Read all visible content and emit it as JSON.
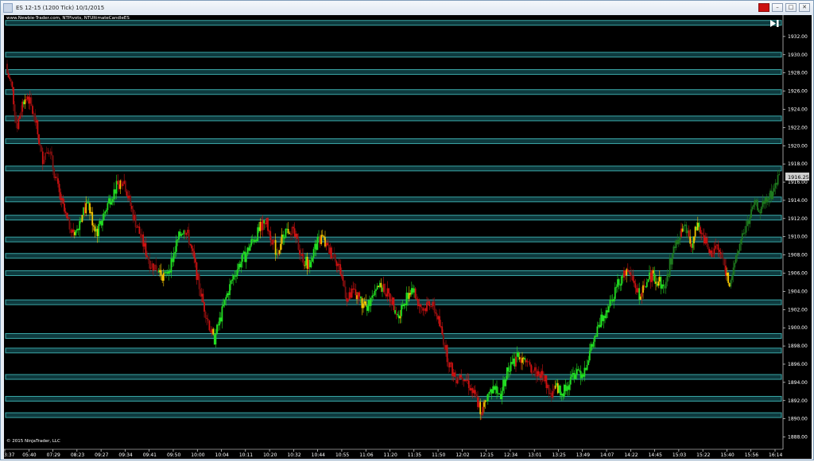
{
  "window": {
    "title": "ES 12-15 (1200 Tick)  10/1/2015",
    "buttons": {
      "close_color": "#cc1111"
    }
  },
  "chart": {
    "caption": "www.Newbie-Trader.com, NTPivots, NTUltimateCandleES",
    "copyright": "© 2015 NinjaTrader, LLC",
    "current_price": "1916.25"
  },
  "chart_data": {
    "type": "candlestick",
    "y_range": [
      1887,
      1934
    ],
    "y_ticks": [
      "1932.00",
      "1930.00",
      "1928.00",
      "1926.00",
      "1924.00",
      "1922.00",
      "1920.00",
      "1918.00",
      "1916.00",
      "1914.00",
      "1912.00",
      "1910.00",
      "1908.00",
      "1906.00",
      "1904.00",
      "1902.00",
      "1900.00",
      "1898.00",
      "1896.00",
      "1894.00",
      "1892.00",
      "1890.00",
      "1888.00"
    ],
    "x_ticks": [
      "3:37",
      "05:40",
      "07:29",
      "08:23",
      "09:27",
      "09:34",
      "09:41",
      "09:50",
      "10:00",
      "10:04",
      "10:11",
      "10:20",
      "10:32",
      "10:44",
      "10:55",
      "11:06",
      "11:20",
      "11:35",
      "11:50",
      "12:02",
      "12:15",
      "12:34",
      "13:01",
      "13:25",
      "13:49",
      "14:07",
      "14:22",
      "14:45",
      "15:03",
      "15:22",
      "15:40",
      "15:56",
      "16:14"
    ],
    "pivot_levels": [
      1933.5,
      1930.0,
      1928.1,
      1925.9,
      1923.0,
      1920.5,
      1917.5,
      1914.1,
      1912.1,
      1909.7,
      1907.9,
      1906.0,
      1902.8,
      1899.1,
      1897.5,
      1894.6,
      1892.2,
      1890.4
    ],
    "price_path": [
      [
        0,
        1929
      ],
      [
        10,
        1926.5
      ],
      [
        16,
        1922
      ],
      [
        24,
        1925
      ],
      [
        30,
        1925.5
      ],
      [
        40,
        1922.5
      ],
      [
        48,
        1918.5
      ],
      [
        56,
        1920
      ],
      [
        62,
        1917.5
      ],
      [
        70,
        1914.5
      ],
      [
        80,
        1911.5
      ],
      [
        90,
        1910.5
      ],
      [
        98,
        1912.5
      ],
      [
        106,
        1913.5
      ],
      [
        112,
        1911.5
      ],
      [
        118,
        1910.5
      ],
      [
        124,
        1912
      ],
      [
        132,
        1914
      ],
      [
        142,
        1915.5
      ],
      [
        150,
        1916.5
      ],
      [
        156,
        1914.5
      ],
      [
        162,
        1912.5
      ],
      [
        168,
        1911
      ],
      [
        176,
        1909
      ],
      [
        184,
        1907
      ],
      [
        194,
        1906.5
      ],
      [
        202,
        1905.5
      ],
      [
        210,
        1907
      ],
      [
        218,
        1909.5
      ],
      [
        226,
        1911
      ],
      [
        232,
        1910
      ],
      [
        240,
        1907
      ],
      [
        248,
        1903.5
      ],
      [
        256,
        1901
      ],
      [
        264,
        1898.5
      ],
      [
        272,
        1901
      ],
      [
        280,
        1903.5
      ],
      [
        288,
        1905.5
      ],
      [
        296,
        1907
      ],
      [
        304,
        1908
      ],
      [
        312,
        1909.5
      ],
      [
        320,
        1910.5
      ],
      [
        328,
        1912
      ],
      [
        336,
        1910
      ],
      [
        344,
        1908
      ],
      [
        352,
        1910.5
      ],
      [
        360,
        1911
      ],
      [
        368,
        1909.5
      ],
      [
        376,
        1907.5
      ],
      [
        384,
        1907
      ],
      [
        392,
        1909
      ],
      [
        400,
        1910
      ],
      [
        408,
        1908.5
      ],
      [
        416,
        1908
      ],
      [
        424,
        1906
      ],
      [
        432,
        1903
      ],
      [
        440,
        1904
      ],
      [
        448,
        1903
      ],
      [
        456,
        1902
      ],
      [
        464,
        1904
      ],
      [
        472,
        1905
      ],
      [
        480,
        1904
      ],
      [
        488,
        1903
      ],
      [
        496,
        1901.5
      ],
      [
        504,
        1903
      ],
      [
        512,
        1904.5
      ],
      [
        520,
        1903
      ],
      [
        528,
        1902
      ],
      [
        536,
        1903
      ],
      [
        544,
        1901.5
      ],
      [
        552,
        1899
      ],
      [
        560,
        1896
      ],
      [
        568,
        1894.5
      ],
      [
        576,
        1895
      ],
      [
        584,
        1894
      ],
      [
        592,
        1892.5
      ],
      [
        600,
        1891
      ],
      [
        608,
        1892.5
      ],
      [
        616,
        1893.5
      ],
      [
        624,
        1892.5
      ],
      [
        632,
        1895
      ],
      [
        640,
        1896
      ],
      [
        648,
        1897
      ],
      [
        656,
        1896
      ],
      [
        664,
        1895.5
      ],
      [
        672,
        1895
      ],
      [
        680,
        1894.5
      ],
      [
        688,
        1892.5
      ],
      [
        696,
        1893.5
      ],
      [
        704,
        1893
      ],
      [
        712,
        1894
      ],
      [
        720,
        1895.5
      ],
      [
        728,
        1895
      ],
      [
        736,
        1897
      ],
      [
        744,
        1899
      ],
      [
        752,
        1901
      ],
      [
        760,
        1902.5
      ],
      [
        768,
        1904
      ],
      [
        776,
        1905.5
      ],
      [
        784,
        1906.5
      ],
      [
        792,
        1905
      ],
      [
        800,
        1903.5
      ],
      [
        808,
        1905
      ],
      [
        816,
        1906
      ],
      [
        824,
        1905
      ],
      [
        832,
        1904.5
      ],
      [
        840,
        1908
      ],
      [
        848,
        1909.5
      ],
      [
        856,
        1911
      ],
      [
        864,
        1909
      ],
      [
        872,
        1911
      ],
      [
        880,
        1910
      ],
      [
        888,
        1908
      ],
      [
        896,
        1909
      ],
      [
        904,
        1907.5
      ],
      [
        912,
        1905
      ],
      [
        920,
        1907
      ],
      [
        928,
        1910
      ],
      [
        936,
        1911.5
      ],
      [
        944,
        1913.5
      ],
      [
        952,
        1913
      ],
      [
        960,
        1914
      ],
      [
        968,
        1915
      ],
      [
        976,
        1917
      ]
    ],
    "colors": {
      "background": "#000000",
      "pivot_line": "#3aa6a6",
      "pivot_fill": "#0e3a3e",
      "strong_down": "#cc1111",
      "weak_down": "#7a0e0e",
      "strong_up": "#22dd22",
      "weak_up": "#1e7a1e",
      "neutral": "#f5c400"
    }
  }
}
